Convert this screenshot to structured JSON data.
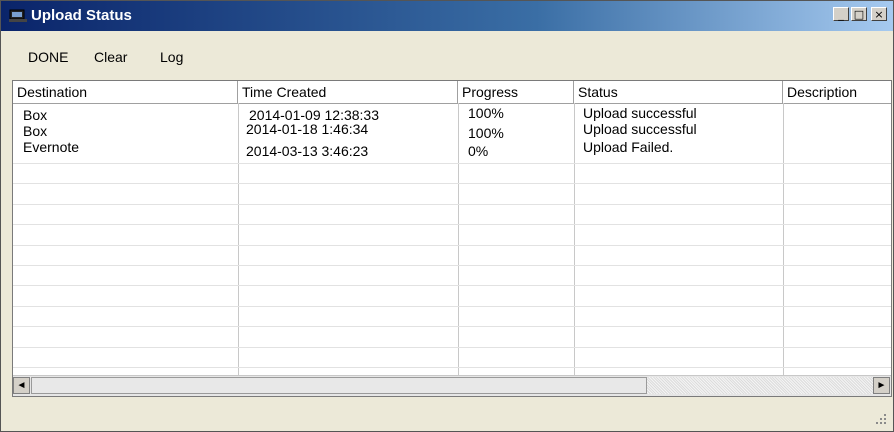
{
  "window": {
    "title": "Upload Status",
    "controls": {
      "minimize": "_",
      "maximize": "□",
      "close": "×"
    }
  },
  "menu": {
    "items": [
      "DONE",
      "Clear",
      "Log"
    ]
  },
  "table": {
    "columns": [
      "Destination",
      "Time Created",
      "Progress",
      "Status",
      "Description"
    ],
    "rows": [
      {
        "destination": "Box",
        "time_created": "2014-01-09 12:38:33",
        "progress": "100%",
        "status": "Upload successful",
        "description": ""
      },
      {
        "destination": "Box",
        "time_created": "2014-01-18 1:46:34",
        "progress": "100%",
        "status": "Upload successful",
        "description": ""
      },
      {
        "destination": "Evernote",
        "time_created": "2014-03-13  3:46:23",
        "progress": "0%",
        "status": "Upload Failed.",
        "description": ""
      }
    ]
  },
  "scrollbar": {
    "left_arrow": "◄",
    "right_arrow": "►"
  },
  "colors": {
    "titlebar_start": "#0a246a",
    "titlebar_end": "#a6caf0",
    "window_bg": "#ece9d8"
  }
}
